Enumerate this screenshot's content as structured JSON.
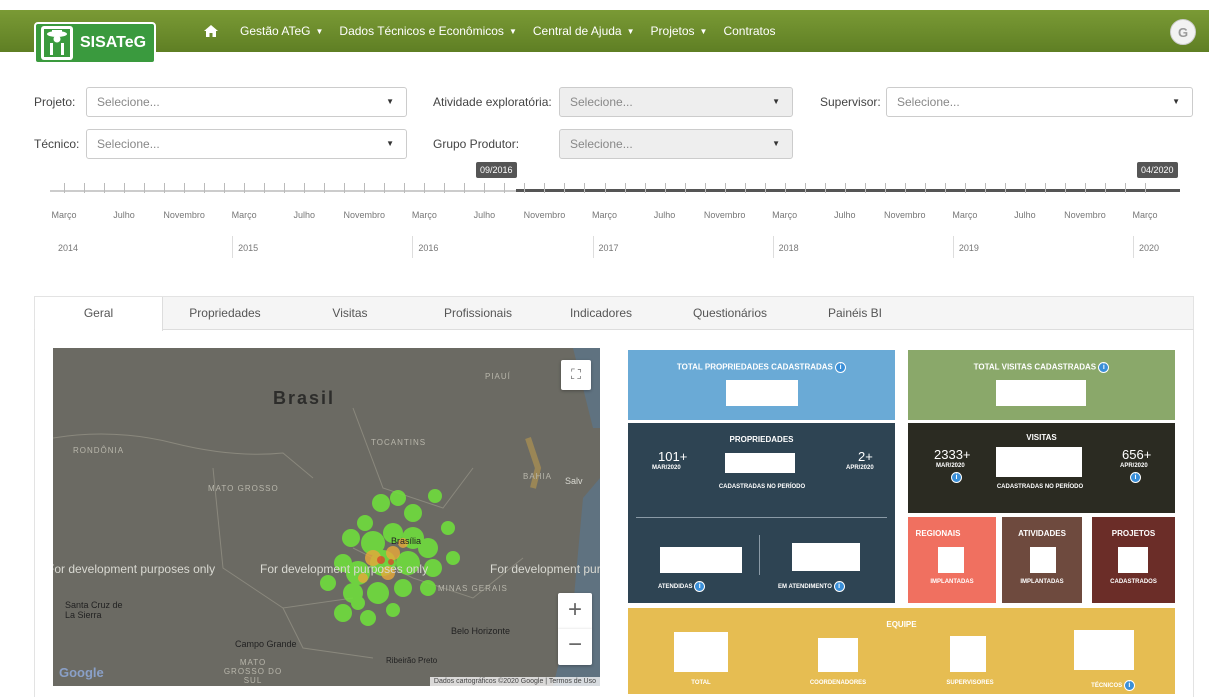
{
  "nav": {
    "brand": "SISATeG",
    "items": [
      {
        "label": "Gestão ATeG",
        "dropdown": true
      },
      {
        "label": "Dados Técnicos e Econômicos",
        "dropdown": true
      },
      {
        "label": "Central de Ajuda",
        "dropdown": true
      },
      {
        "label": "Projetos",
        "dropdown": true
      },
      {
        "label": "Contratos",
        "dropdown": false
      }
    ],
    "avatar": "G"
  },
  "filters": {
    "projeto_label": "Projeto:",
    "projeto_value": "Selecione...",
    "atividade_label": "Atividade exploratória:",
    "atividade_value": "Selecione...",
    "supervisor_label": "Supervisor:",
    "supervisor_value": "Selecione...",
    "tecnico_label": "Técnico:",
    "tecnico_value": "Selecione...",
    "grupo_label": "Grupo Produtor:",
    "grupo_value": "Selecione..."
  },
  "timeline": {
    "start_flag": "09/2016",
    "end_flag": "04/2020",
    "months": [
      "Março",
      "Julho",
      "Novembro",
      "Março",
      "Julho",
      "Novembro",
      "Março",
      "Julho",
      "Novembro",
      "Março",
      "Julho",
      "Novembro",
      "Março",
      "Julho",
      "Novembro",
      "Março",
      "Julho",
      "Novembro",
      "Março"
    ],
    "years": [
      "2014",
      "2015",
      "2016",
      "2017",
      "2018",
      "2019",
      "2020"
    ]
  },
  "tabs": [
    "Geral",
    "Propriedades",
    "Visitas",
    "Profissionais",
    "Indicadores",
    "Questionários",
    "Painéis BI"
  ],
  "map": {
    "country": "Brasil",
    "labels": [
      "RONDÔNIA",
      "MATO GROSSO",
      "TOCANTINS",
      "BAHIA",
      "PIAUÍ",
      "MINAS GERAIS",
      "MATO GROSSO DO SUL"
    ],
    "cities": [
      "Brasília",
      "Santa Cruz de La Sierra",
      "Campo Grande",
      "Belo Horizonte",
      "Ribeirão Preto",
      "Salv"
    ],
    "dev_text": "For development purposes only",
    "credits": "Dados cartográficos ©2020 Google  |  Termos de Uso",
    "google": "Google"
  },
  "cards": {
    "total_propriedades": "TOTAL PROPRIEDADES CADASTRADAS",
    "total_visitas": "TOTAL VISITAS CADASTRADAS",
    "propriedades_title": "PROPRIEDADES",
    "prop_left_value": "101+",
    "prop_left_date": "MAR/2020",
    "prop_right_value": "2+",
    "prop_right_date": "APR/2020",
    "prop_center_caption": "CADASTRADAS NO PERÍODO",
    "atendidas": "ATENDIDAS",
    "em_atendimento": "EM ATENDIMENTO",
    "visitas_title": "VISITAS",
    "vis_left_value": "2333+",
    "vis_left_date": "MAR/2020",
    "vis_right_value": "656+",
    "vis_right_date": "APR/2020",
    "vis_center_caption": "CADASTRADAS NO PERÍODO",
    "regionais": "REGIONAIS",
    "regionais_caption": "IMPLANTADAS",
    "atividades": "ATIVIDADES",
    "atividades_caption": "IMPLANTADAS",
    "projetos": "PROJETOS",
    "projetos_caption": "CADASTRADOS",
    "equipe": "EQUIPE",
    "equipe_total": "TOTAL",
    "equipe_coord": "COORDENADORES",
    "equipe_sup": "SUPERVISORES",
    "equipe_tec": "TÉCNICOS"
  },
  "colors": {
    "nav": "#6e8f2b",
    "card_blue": "#6aaad6",
    "card_green": "#8aa86a",
    "card_navy": "#2e4453",
    "card_dark": "#2b2b22",
    "card_salmon": "#f07060",
    "card_brown": "#6e4a3e",
    "card_maroon": "#6b2d28",
    "card_yellow": "#e6bd52"
  }
}
